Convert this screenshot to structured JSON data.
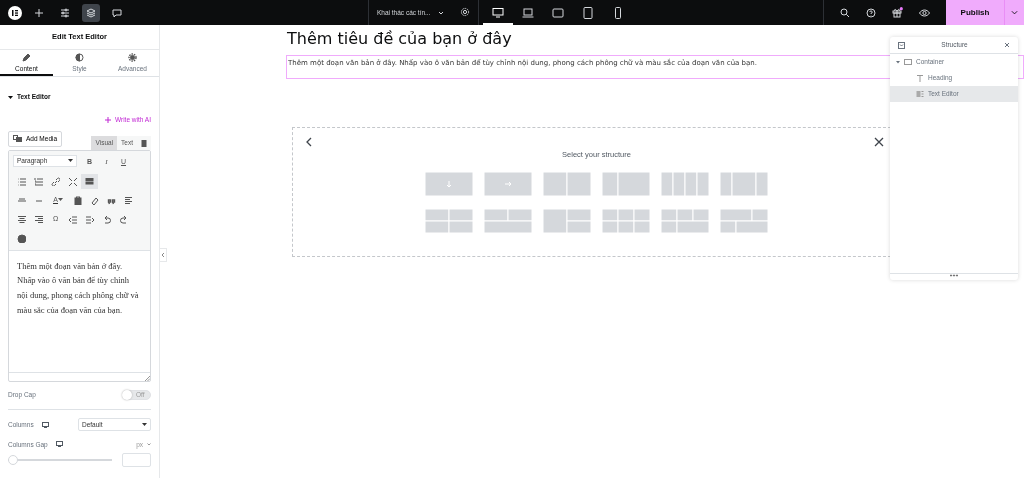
{
  "topbar": {
    "page_title": "Khai thác các tín...",
    "devices": [
      {
        "selected": true
      },
      {
        "selected": false
      },
      {
        "selected": false
      },
      {
        "selected": false
      },
      {
        "selected": false
      }
    ],
    "gift": {
      "has_notification": true
    },
    "publish": "Publish"
  },
  "panel": {
    "title": "Edit Text Editor",
    "tabs": [
      {
        "label": "Content",
        "selected": true
      },
      {
        "label": "Style",
        "selected": false
      },
      {
        "label": "Advanced",
        "selected": false
      }
    ],
    "section": {
      "title": "Text Editor",
      "expanded": true
    },
    "ai_link": "Write with AI",
    "add_media": "Add Media",
    "editor_tabs": [
      {
        "label": "Visual",
        "selected": true
      },
      {
        "label": "Text",
        "selected": false
      }
    ],
    "toolbar": {
      "format": "Paragraph",
      "letters": [
        "B",
        "I",
        "U",
        "A",
        "Ω"
      ],
      "toggle_on": true
    },
    "content": "Thêm một đoạn văn bản ở đây. Nhấp vào ô văn bản để tùy chỉnh nội dung, phong cách phông chữ và màu sắc của đoạn văn của bạn.",
    "drop_cap": {
      "label": "Drop Cap",
      "on": false,
      "off_text": "Off"
    },
    "columns": {
      "label": "Columns",
      "value": "Default"
    },
    "columns_gap": {
      "label": "Columns Gap",
      "unit": "px",
      "level": 0
    }
  },
  "canvas": {
    "heading": "Thêm tiêu đề của bạn ở đây",
    "paragraph": "Thêm một đoạn văn bản ở đây. Nhấp vào ô văn bản để tùy chỉnh nội dung, phong cách phông chữ và màu sắc của đoạn văn của bạn.",
    "selector_title": "Select your structure"
  },
  "structure": {
    "title": "Structure",
    "tree": [
      {
        "label": "Container",
        "kind": "container",
        "expanded": true,
        "selected": false,
        "children": [
          {
            "label": "Heading",
            "kind": "heading",
            "selected": false
          },
          {
            "label": "Text Editor",
            "kind": "text-editor",
            "selected": true
          }
        ]
      }
    ]
  }
}
